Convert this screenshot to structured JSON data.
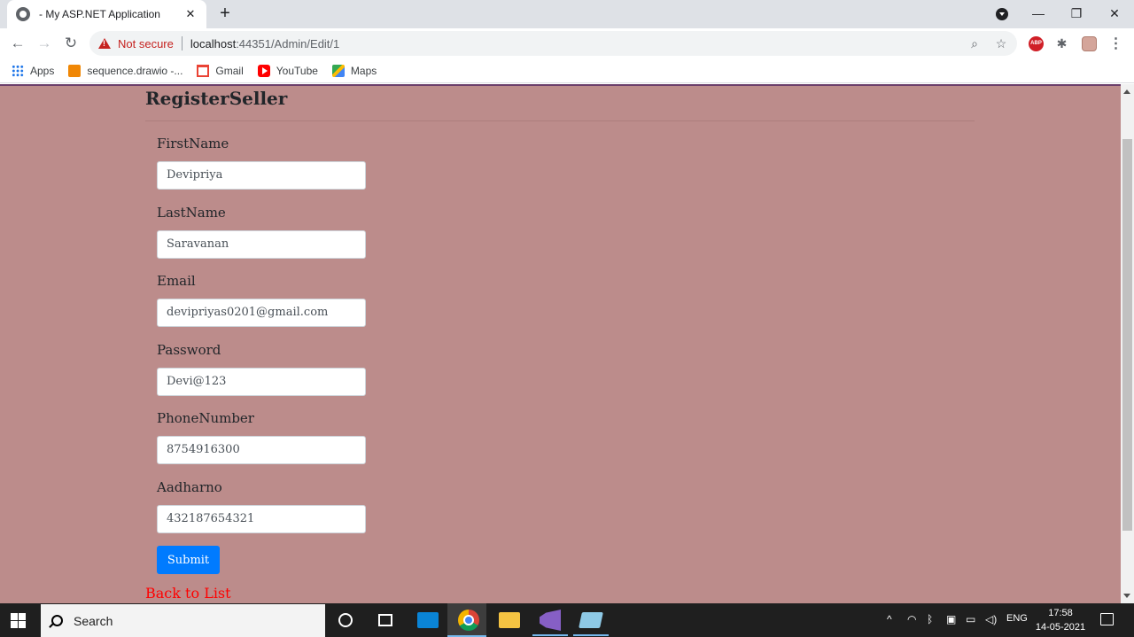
{
  "browser": {
    "tab_title": "- My ASP.NET Application",
    "tab_close": "✕",
    "new_tab": "+",
    "window_controls": {
      "minimize": "—",
      "restore": "❐",
      "close": "✕"
    },
    "security_label": "Not secure",
    "url_host": "localhost",
    "url_path": ":44351/Admin/Edit/1",
    "bookmarks": [
      {
        "label": "Apps",
        "icon": "apps-grid-icon"
      },
      {
        "label": "sequence.drawio -...",
        "icon": "drawio-icon"
      },
      {
        "label": "Gmail",
        "icon": "gmail-icon"
      },
      {
        "label": "YouTube",
        "icon": "youtube-icon"
      },
      {
        "label": "Maps",
        "icon": "maps-icon"
      }
    ],
    "extensions": {
      "abp_label": "ABP"
    }
  },
  "page": {
    "background_color": "#bc8c8b",
    "heading": "RegisterSeller",
    "fields": [
      {
        "label": "FirstName",
        "value": "Devipriya"
      },
      {
        "label": "LastName",
        "value": "Saravanan"
      },
      {
        "label": "Email",
        "value": "devipriyas0201@gmail.com"
      },
      {
        "label": "Password",
        "value": "Devi@123"
      },
      {
        "label": "PhoneNumber",
        "value": "8754916300"
      },
      {
        "label": "Aadharno",
        "value": "432187654321"
      }
    ],
    "submit_label": "Submit",
    "submit_color": "#007bff",
    "back_link": "Back to List",
    "back_link_color": "#ff0000"
  },
  "taskbar": {
    "search_text": "Search",
    "language": "ENG",
    "time": "17:58",
    "date": "14-05-2021"
  }
}
